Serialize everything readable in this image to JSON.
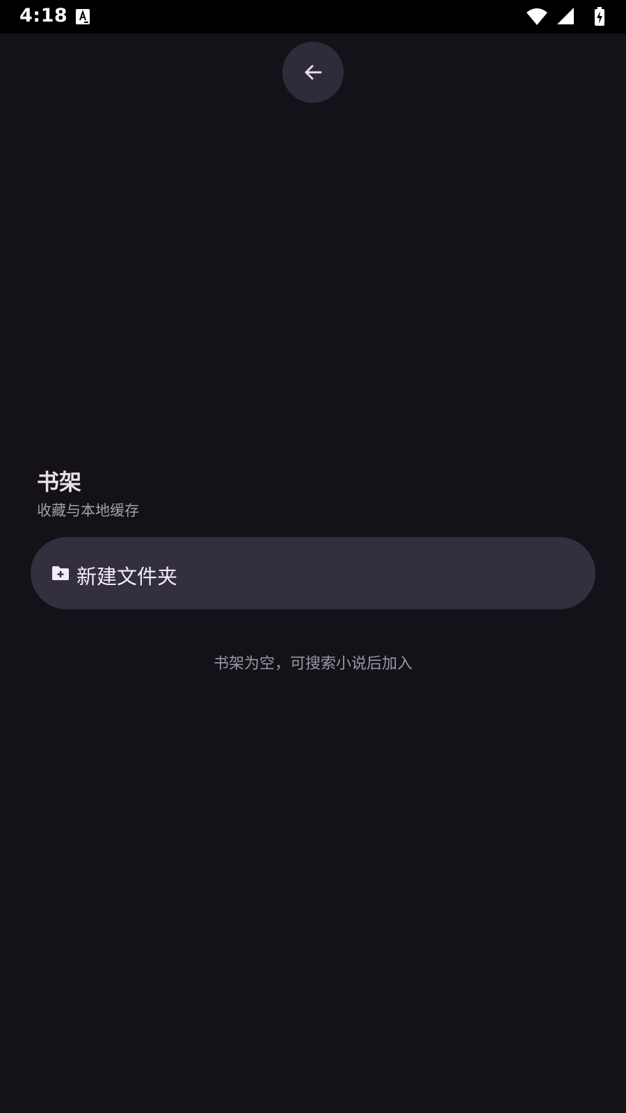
{
  "status_bar": {
    "time": "4:18",
    "notification_icon": "a-letter-notification-icon",
    "wifi_icon": "wifi-icon",
    "signal_icon": "cell-signal-icon",
    "battery_icon": "battery-charging-icon"
  },
  "toolbar": {
    "back_icon": "arrow-left-icon"
  },
  "header": {
    "title": "书架",
    "subtitle": "收藏与本地缓存"
  },
  "actions": {
    "new_folder_label": "新建文件夹",
    "new_folder_icon": "folder-plus-icon"
  },
  "empty_state": {
    "message": "书架为空，可搜索小说后加入"
  },
  "colors": {
    "background": "#141218",
    "surface_button": "#332f3f",
    "back_button": "#2f2b39",
    "accent_icon": "#e9ddff"
  }
}
